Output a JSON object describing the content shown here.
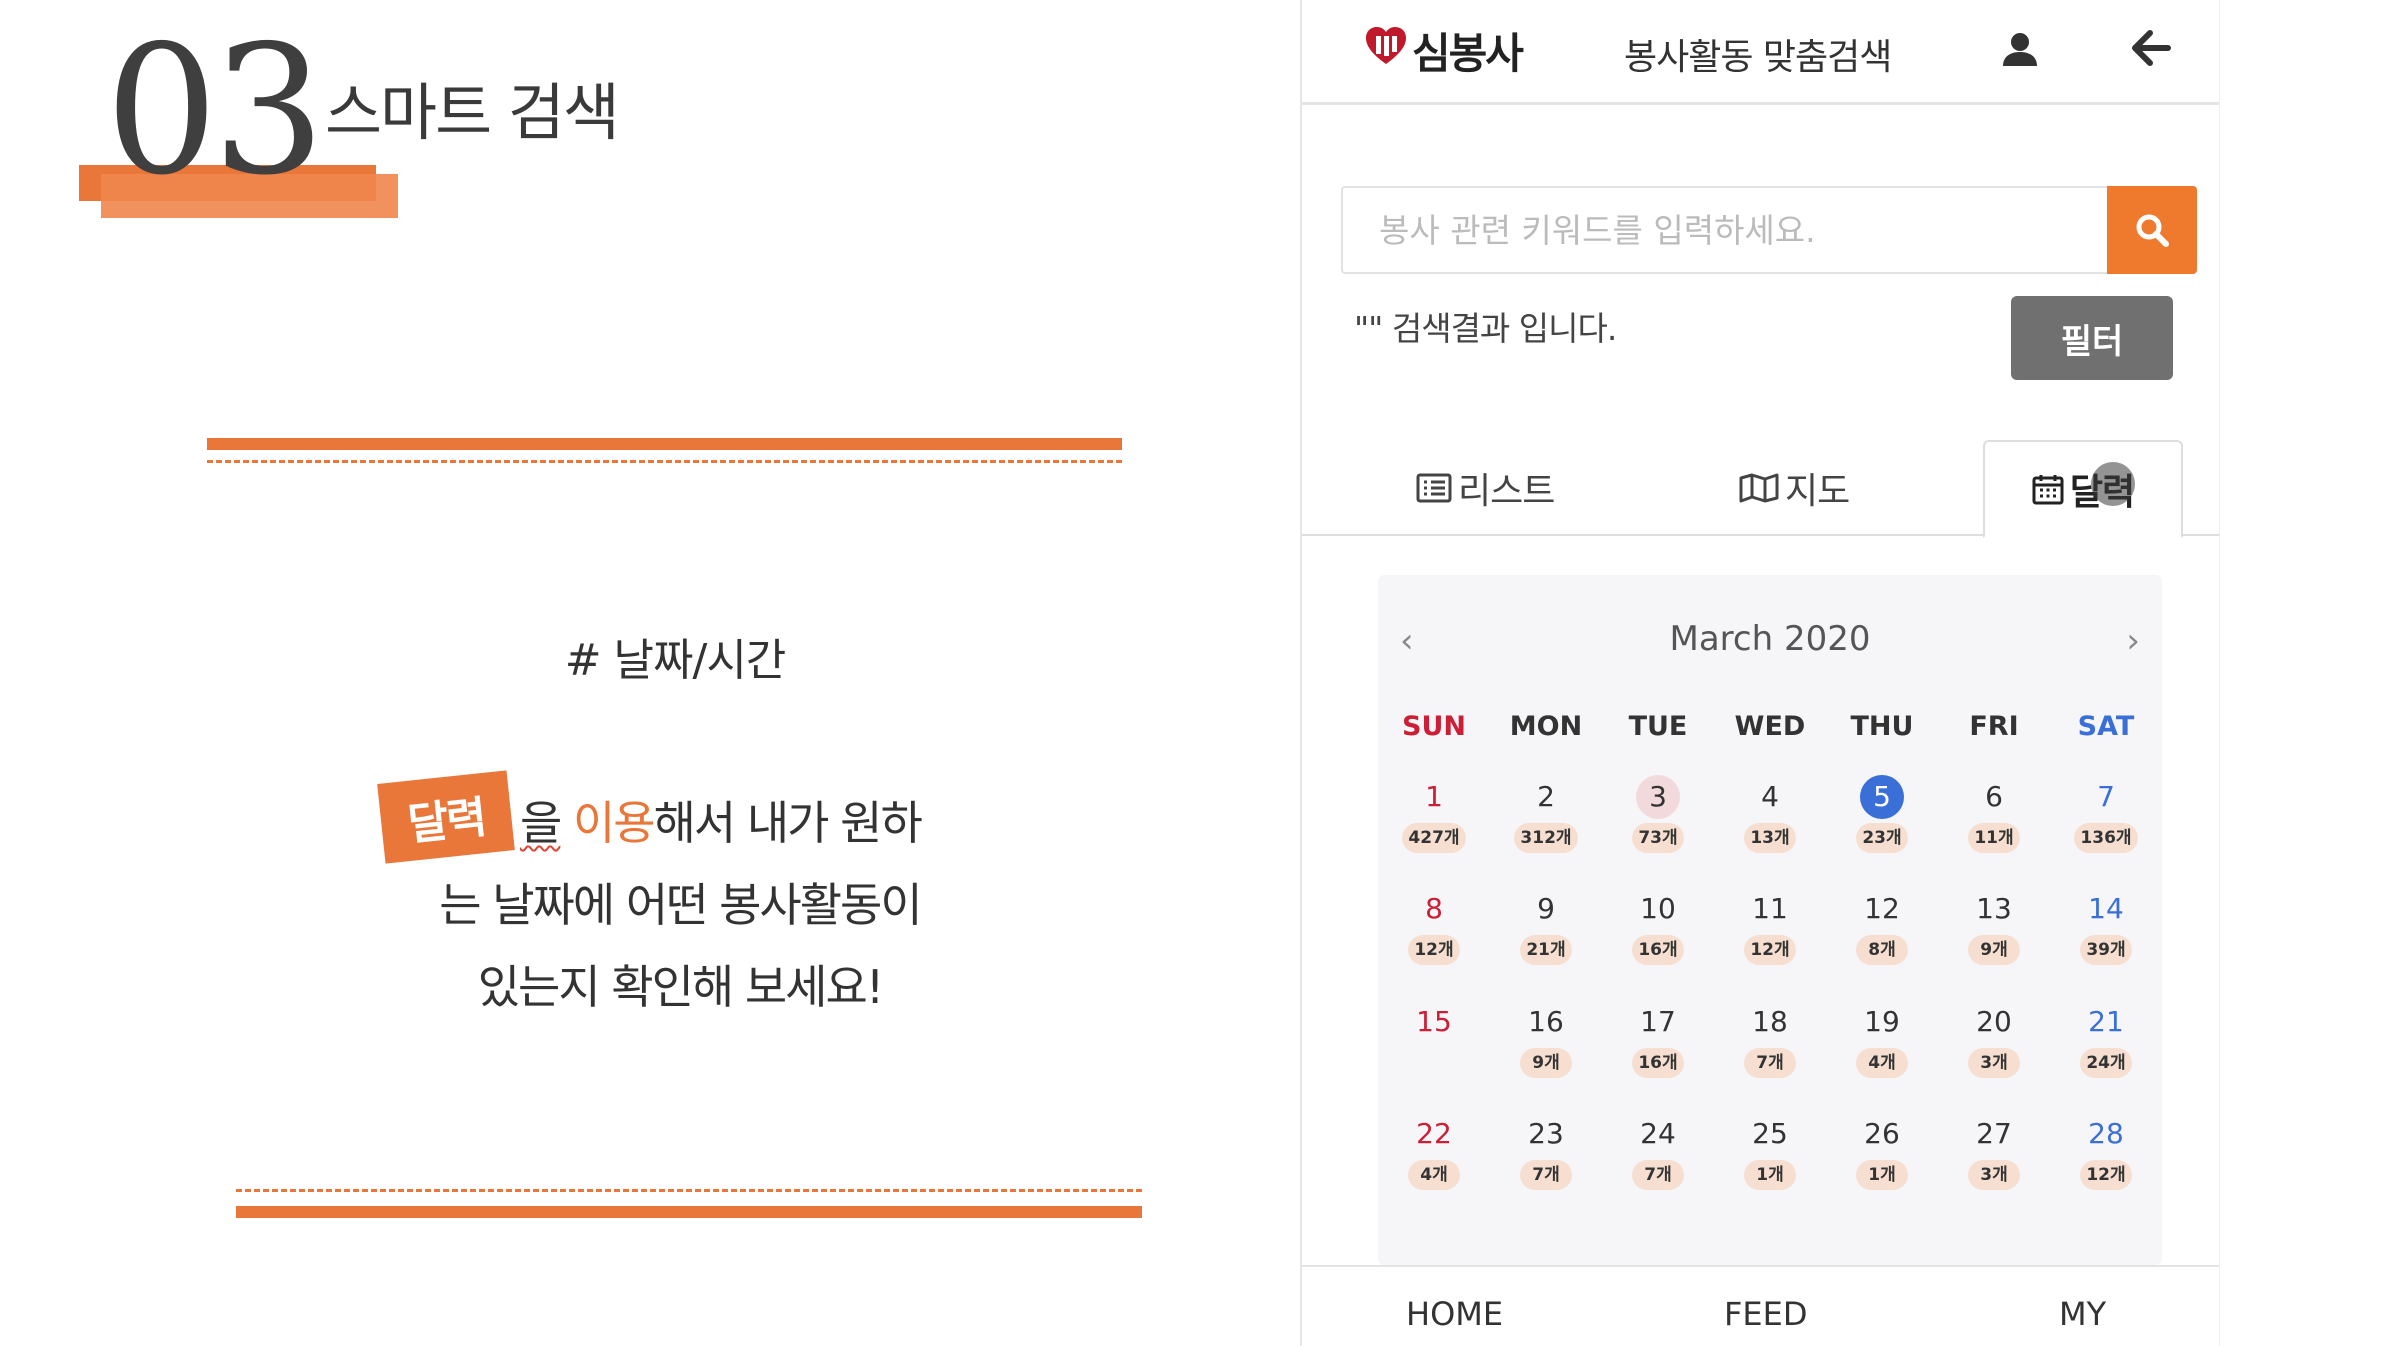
{
  "section": {
    "number": "03",
    "title": "스마트 검색"
  },
  "slide": {
    "hashtag": "# 날짜/시간",
    "highlight_tag": "달력",
    "line1_particle": "을",
    "line1_orange": "이용",
    "line1_rest": "해서 내가 원하",
    "line2": "는 날짜에 어떤 봉사활동이",
    "line3": "있는지 확인해 보세요!"
  },
  "app": {
    "logo_mark": "♡",
    "logo_text": "심봉사",
    "title": "봉사활동 맞춤검색",
    "search_placeholder": "봉사 관련 키워드를 입력하세요.",
    "result_text": "\"\" 검색결과 입니다.",
    "filter_label": "필터",
    "tabs": [
      {
        "label": "리스트",
        "icon": "list-icon"
      },
      {
        "label": "지도",
        "icon": "map-icon"
      },
      {
        "label": "달력",
        "icon": "calendar-icon",
        "active": true
      }
    ],
    "colors": {
      "accent": "#ef7a2e",
      "sunday": "#cc1f36",
      "saturday": "#3a6fd8",
      "today": "#3a6fd8",
      "count_badge": "#f6dfd0"
    }
  },
  "calendar": {
    "month_label": "March 2020",
    "prev": "‹",
    "next": "›",
    "weekdays": [
      "SUN",
      "MON",
      "TUE",
      "WED",
      "THU",
      "FRI",
      "SAT"
    ],
    "weeks": [
      [
        {
          "day": "1",
          "count": "427개"
        },
        {
          "day": "2",
          "count": "312개"
        },
        {
          "day": "3",
          "count": "73개",
          "mark": "highlight"
        },
        {
          "day": "4",
          "count": "13개"
        },
        {
          "day": "5",
          "count": "23개",
          "mark": "today"
        },
        {
          "day": "6",
          "count": "11개"
        },
        {
          "day": "7",
          "count": "136개"
        }
      ],
      [
        {
          "day": "8",
          "count": "12개"
        },
        {
          "day": "9",
          "count": "21개"
        },
        {
          "day": "10",
          "count": "16개"
        },
        {
          "day": "11",
          "count": "12개"
        },
        {
          "day": "12",
          "count": "8개"
        },
        {
          "day": "13",
          "count": "9개"
        },
        {
          "day": "14",
          "count": "39개"
        }
      ],
      [
        {
          "day": "15",
          "count": ""
        },
        {
          "day": "16",
          "count": "9개"
        },
        {
          "day": "17",
          "count": "16개"
        },
        {
          "day": "18",
          "count": "7개"
        },
        {
          "day": "19",
          "count": "4개"
        },
        {
          "day": "20",
          "count": "3개"
        },
        {
          "day": "21",
          "count": "24개"
        }
      ],
      [
        {
          "day": "22",
          "count": "4개"
        },
        {
          "day": "23",
          "count": "7개"
        },
        {
          "day": "24",
          "count": "7개"
        },
        {
          "day": "25",
          "count": "1개"
        },
        {
          "day": "26",
          "count": "1개"
        },
        {
          "day": "27",
          "count": "3개"
        },
        {
          "day": "28",
          "count": "12개"
        }
      ]
    ]
  },
  "bottom_nav": [
    "HOME",
    "FEED",
    "MY"
  ]
}
